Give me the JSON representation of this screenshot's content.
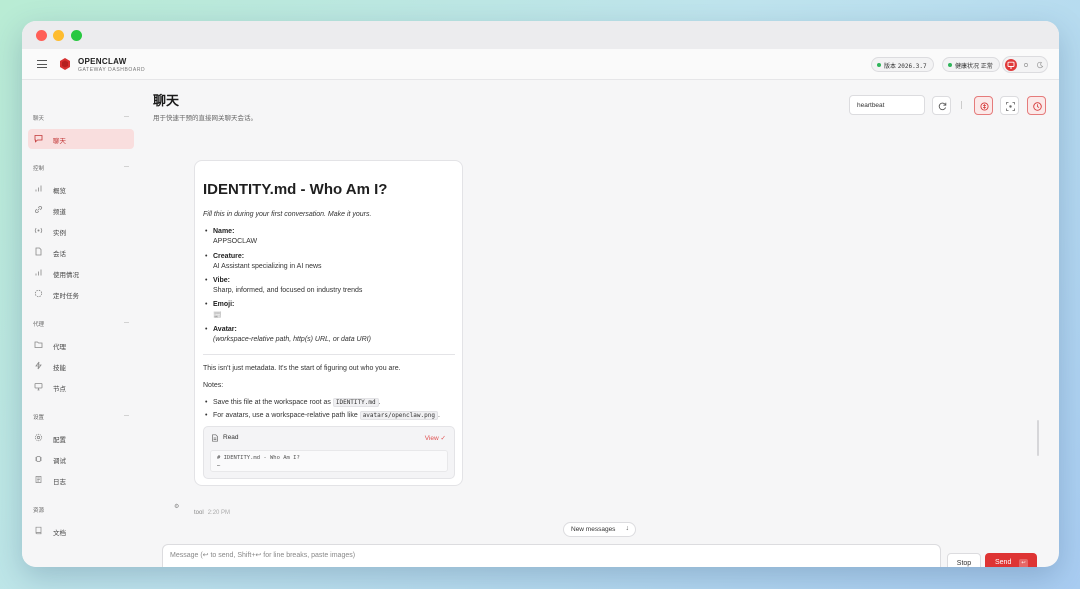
{
  "header": {
    "brand_title": "OPENCLAW",
    "brand_sub": "GATEWAY DASHBOARD",
    "version_label": "版本",
    "version_value": "2026.3.7",
    "health_label": "健康状况",
    "health_value": "正常"
  },
  "sidebar": {
    "sections": [
      {
        "title": "聊天",
        "items": [
          {
            "label": "聊天",
            "icon": "chat-icon",
            "active": true
          }
        ]
      },
      {
        "title": "控制",
        "items": [
          {
            "label": "概览",
            "icon": "bar-chart-icon"
          },
          {
            "label": "频道",
            "icon": "link-icon"
          },
          {
            "label": "实例",
            "icon": "radio-icon"
          },
          {
            "label": "会话",
            "icon": "document-icon"
          },
          {
            "label": "使用情况",
            "icon": "bar-chart-icon"
          },
          {
            "label": "定时任务",
            "icon": "timer-icon"
          }
        ]
      },
      {
        "title": "代理",
        "items": [
          {
            "label": "代理",
            "icon": "folder-icon"
          },
          {
            "label": "技能",
            "icon": "zap-icon"
          },
          {
            "label": "节点",
            "icon": "monitor-icon"
          }
        ]
      },
      {
        "title": "设置",
        "items": [
          {
            "label": "配置",
            "icon": "gear-icon"
          },
          {
            "label": "调试",
            "icon": "bug-icon"
          },
          {
            "label": "日志",
            "icon": "log-icon"
          }
        ]
      },
      {
        "title": "资源",
        "items": [
          {
            "label": "文档",
            "icon": "book-icon"
          }
        ]
      }
    ]
  },
  "main": {
    "title": "聊天",
    "subtitle": "用于快速干预的直接网关聊天会话。",
    "session_value": "heartbeat"
  },
  "message": {
    "h1": "IDENTITY.md - Who Am I?",
    "intro": "Fill this in during your first conversation. Make it yours.",
    "fields": [
      {
        "key": "Name:",
        "value": "APPSOCLAW",
        "italic": false
      },
      {
        "key": "Creature:",
        "value": "AI Assistant specializing in AI news",
        "italic": false
      },
      {
        "key": "Vibe:",
        "value": "Sharp, informed, and focused on industry trends",
        "italic": false
      },
      {
        "key": "Emoji:",
        "value": "📰",
        "italic": false
      },
      {
        "key": "Avatar:",
        "value": "(workspace-relative path, http(s) URL, or data URI)",
        "italic": true
      }
    ],
    "para": "This isn't just metadata. It's the start of figuring out who you are.",
    "notes_label": "Notes:",
    "note1_pre": "Save this file at the workspace root as",
    "note1_code": "IDENTITY.md",
    "note1_post": ".",
    "note2_pre": "For avatars, use a workspace-relative path like",
    "note2_code": "avatars/openclaw.png",
    "note2_post": ".",
    "tool_read": "Read",
    "tool_view": "View ✓",
    "tool_code_line1": "# IDENTITY.md - Who Am I?",
    "tool_code_line2": "…",
    "sender": "tool",
    "time": "2:20 PM"
  },
  "composer": {
    "new_messages": "New messages",
    "placeholder": "Message (↩ to send, Shift+↩ for line breaks, paste images)",
    "stop": "Stop",
    "send": "Send",
    "send_kbd": "↩"
  },
  "colors": {
    "accent": "#de3434",
    "active_bg": "#f9dede",
    "ok": "#2fb55a"
  }
}
